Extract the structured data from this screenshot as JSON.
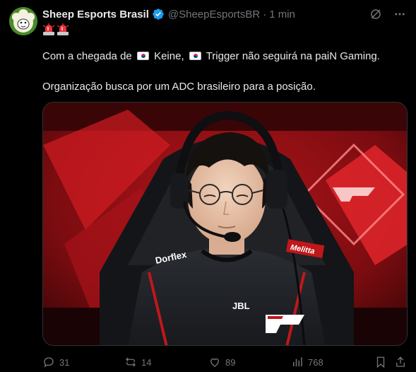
{
  "author": {
    "display_name": "Sheep Esports Brasil",
    "handle": "@SheepEsportsBR",
    "separator": "·",
    "time": "1 min",
    "avatar_icon": "sheep-logo",
    "verified_color": "#1d9bf0"
  },
  "post": {
    "emoji_line": [
      "police-light-icon",
      "police-light-icon"
    ],
    "line1": {
      "part1": "Com a chegada de ",
      "part2": " Keine, ",
      "part3": " Trigger não seguirá na paiN Gaming."
    },
    "line2": "Organização busca por um ADC brasileiro para a posição.",
    "flags": [
      "south-korea-flag",
      "south-korea-flag"
    ]
  },
  "media": {
    "type": "photo",
    "jersey_sponsors": [
      "Dorflex",
      "Melitta",
      "JBL"
    ],
    "background_color": "#c0171a"
  },
  "actions": {
    "replies": "31",
    "reposts": "14",
    "likes": "89",
    "views": "768"
  }
}
